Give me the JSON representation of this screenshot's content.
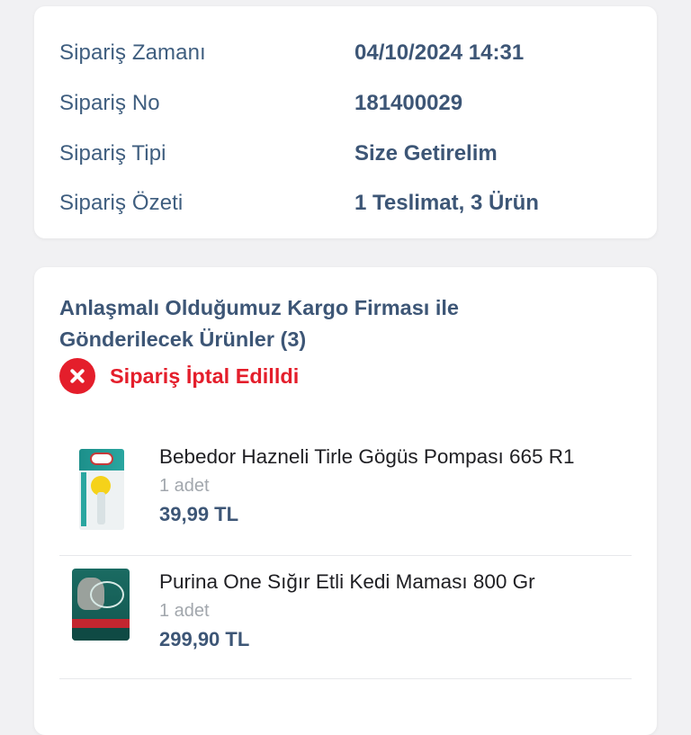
{
  "order_info": {
    "rows": [
      {
        "label": "Sipariş Zamanı",
        "value": "04/10/2024 14:31"
      },
      {
        "label": "Sipariş No",
        "value": "181400029"
      },
      {
        "label": "Sipariş Tipi",
        "value": "Size Getirelim"
      },
      {
        "label": "Sipariş Özeti",
        "value": "1 Teslimat, 3 Ürün"
      }
    ]
  },
  "shipment": {
    "title": "Anlaşmalı Olduğumuz Kargo Firması ile Gönderilecek Ürünler (3)",
    "status_text": "Sipariş İptal Edilldi",
    "status_icon": "cancel-x-icon",
    "status_color": "#e41e2b",
    "products": [
      {
        "name": "Bebedor Hazneli Tirle Gögüs Pompası 665 R1",
        "quantity": "1 adet",
        "price": "39,99 TL"
      },
      {
        "name": "Purina One Sığır Etli Kedi Maması 800 Gr",
        "quantity": "1 adet",
        "price": "299,90 TL"
      }
    ]
  },
  "colors": {
    "background": "#f1f1f3",
    "label": "#3f5e7f",
    "value": "#3d5676",
    "cancel": "#e41e2b"
  }
}
